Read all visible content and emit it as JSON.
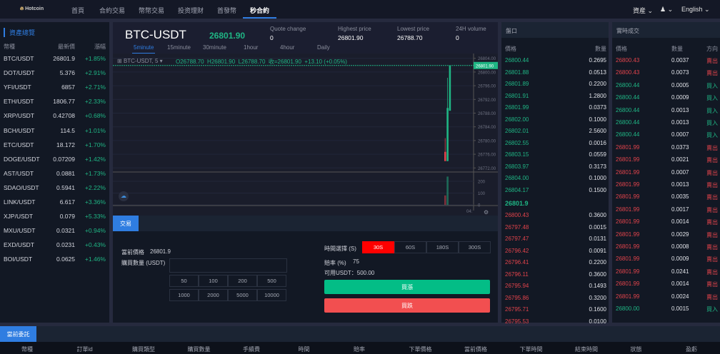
{
  "nav": {
    "logo": "Hotcoin",
    "items": [
      "首頁",
      "合約交易",
      "幣幣交易",
      "投资理财",
      "首發幣",
      "秒合約"
    ],
    "active_index": 5,
    "assets": "資産",
    "user_icon": "user-icon",
    "language": "English"
  },
  "markets": {
    "title": "資產總覽",
    "headers": [
      "幣種",
      "最新價",
      "漲幅"
    ],
    "rows": [
      [
        "BTC/USDT",
        "26801.9",
        "+1.85%"
      ],
      [
        "DOT/USDT",
        "5.376",
        "+2.91%"
      ],
      [
        "YFI/USDT",
        "6857",
        "+2.71%"
      ],
      [
        "ETH/USDT",
        "1806.77",
        "+2.33%"
      ],
      [
        "XRP/USDT",
        "0.42708",
        "+0.68%"
      ],
      [
        "BCH/USDT",
        "114.5",
        "+1.01%"
      ],
      [
        "ETC/USDT",
        "18.172",
        "+1.70%"
      ],
      [
        "DOGE/USDT",
        "0.07209",
        "+1.42%"
      ],
      [
        "AST/USDT",
        "0.0881",
        "+1.73%"
      ],
      [
        "SDAO/USDT",
        "0.5941",
        "+2.22%"
      ],
      [
        "LINK/USDT",
        "6.617",
        "+3.36%"
      ],
      [
        "XJP/USDT",
        "0.079",
        "+5.33%"
      ],
      [
        "MXU/USDT",
        "0.0321",
        "+0.94%"
      ],
      [
        "EXD/USDT",
        "0.0231",
        "+0.43%"
      ],
      [
        "BOI/USDT",
        "0.0625",
        "+1.46%"
      ]
    ]
  },
  "ticker": {
    "pair": "BTC-USDT",
    "price": "26801.90",
    "stats": [
      {
        "label": "Quote change",
        "value": "0"
      },
      {
        "label": "Highest price",
        "value": "26801.90"
      },
      {
        "label": "Lowest price",
        "value": "26788.70"
      },
      {
        "label": "24H volume",
        "value": "0"
      }
    ],
    "intervals": [
      "5minute",
      "15minute",
      "30minute",
      "1hour",
      "4hour",
      "Daily"
    ],
    "active_interval": 0
  },
  "chart": {
    "symbol": "BTC-USDT, 5",
    "ohlc": "O26788.70  H26801.90  L26788.70  收=26801.90  +13.10 (+0.05%)",
    "last_label": "26801.90",
    "price_ticks": [
      "26804.00",
      "26800.00",
      "26796.00",
      "26792.00",
      "26788.00",
      "26784.00",
      "26780.00",
      "26776.00",
      "26772.00"
    ],
    "volume_ticks": [
      "200",
      "100",
      "0"
    ],
    "time_label": "04:",
    "candles": [
      {
        "o": 26776.7,
        "h": 26780.7,
        "l": 26774.0,
        "c": 26774.0,
        "v": 80
      },
      {
        "o": 26774.0,
        "h": 26798.3,
        "l": 26774.0,
        "c": 26789.5,
        "v": 240
      },
      {
        "o": 26788.7,
        "h": 26801.9,
        "l": 26788.7,
        "c": 26801.9,
        "v": 0
      }
    ],
    "up_color": "#1fb584",
    "down_color": "#e0434b"
  },
  "trade": {
    "tab": "交易",
    "current_price_label": "當前價格",
    "current_price": "26801.9",
    "amount_label": "購買數量 (USDT)",
    "amount_value": "",
    "amounts": [
      "50",
      "100",
      "200",
      "500",
      "1000",
      "2000",
      "5000",
      "10000"
    ],
    "time_label": "時間選擇 (S)",
    "times": [
      "30S",
      "60S",
      "180S",
      "300S"
    ],
    "active_time": 0,
    "odds_label": "賠率 (%)",
    "odds": "75",
    "available": "可用USDT：500.00",
    "buy_up": "買漲",
    "buy_down": "買跌"
  },
  "orderbook": {
    "title": "盤口",
    "headers": [
      "價格",
      "數量"
    ],
    "asks": [
      [
        "26800.44",
        "0.2695"
      ],
      [
        "26801.88",
        "0.0513"
      ],
      [
        "26801.89",
        "0.2200"
      ],
      [
        "26801.91",
        "1.2800"
      ],
      [
        "26801.99",
        "0.0373"
      ],
      [
        "26802.00",
        "0.1000"
      ],
      [
        "26802.01",
        "2.5600"
      ],
      [
        "26802.55",
        "0.0016"
      ],
      [
        "26803.15",
        "0.0559"
      ],
      [
        "26803.97",
        "0.3173"
      ],
      [
        "26804.00",
        "0.1000"
      ],
      [
        "26804.17",
        "0.1500"
      ]
    ],
    "mid": "26801.9",
    "bids": [
      [
        "26800.43",
        "0.3600"
      ],
      [
        "26797.48",
        "0.0015"
      ],
      [
        "26797.47",
        "0.0131"
      ],
      [
        "26796.42",
        "0.0091"
      ],
      [
        "26796.41",
        "0.2200"
      ],
      [
        "26796.11",
        "0.3600"
      ],
      [
        "26795.94",
        "0.1493"
      ],
      [
        "26795.86",
        "0.3200"
      ],
      [
        "26795.71",
        "0.1600"
      ],
      [
        "26795.53",
        "0.0100"
      ]
    ]
  },
  "trades": {
    "title": "實時成交",
    "headers": [
      "價格",
      "數量",
      "方向"
    ],
    "rows": [
      [
        "26800.43",
        "0.0037",
        "賣出"
      ],
      [
        "26800.43",
        "0.0073",
        "賣出"
      ],
      [
        "26800.44",
        "0.0005",
        "買入"
      ],
      [
        "26800.44",
        "0.0009",
        "買入"
      ],
      [
        "26800.44",
        "0.0013",
        "買入"
      ],
      [
        "26800.44",
        "0.0013",
        "買入"
      ],
      [
        "26800.44",
        "0.0007",
        "買入"
      ],
      [
        "26801.99",
        "0.0373",
        "賣出"
      ],
      [
        "26801.99",
        "0.0021",
        "賣出"
      ],
      [
        "26801.99",
        "0.0007",
        "賣出"
      ],
      [
        "26801.99",
        "0.0013",
        "賣出"
      ],
      [
        "26801.99",
        "0.0035",
        "賣出"
      ],
      [
        "26801.99",
        "0.0017",
        "賣出"
      ],
      [
        "26801.99",
        "0.0014",
        "賣出"
      ],
      [
        "26801.99",
        "0.0029",
        "賣出"
      ],
      [
        "26801.99",
        "0.0008",
        "賣出"
      ],
      [
        "26801.99",
        "0.0009",
        "賣出"
      ],
      [
        "26801.99",
        "0.0241",
        "賣出"
      ],
      [
        "26801.99",
        "0.0014",
        "賣出"
      ],
      [
        "26801.99",
        "0.0024",
        "賣出"
      ],
      [
        "26800.00",
        "0.0015",
        "買入"
      ]
    ]
  },
  "orders": {
    "tab": "當前委託",
    "headers": [
      "幣種",
      "訂單id",
      "購買類型",
      "購買數量",
      "手續費",
      "時間",
      "賠率",
      "下單價格",
      "當前價格",
      "下單時間",
      "結束時間",
      "狀態",
      "盈虧"
    ]
  }
}
